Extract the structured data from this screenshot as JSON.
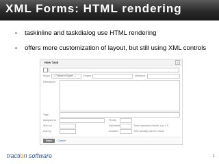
{
  "slide": {
    "title": "XML Forms: HTML rendering",
    "bullets": [
      "taskinline and taskdialog use HTML rendering",
      "offers more customization of layout, but still using XML controls"
    ],
    "footer_brand_prefix": "tracti",
    "footer_brand_dot": "o",
    "footer_brand_suffix": "n software",
    "page_number": "1"
  },
  "dialog": {
    "title": "New Task",
    "close_glyph": "×",
    "fields": {
      "space_label": "Space",
      "space_value": "— Choose a Space —",
      "project_label": "Project",
      "milestone_label": "Milestone",
      "description_label": "Description",
      "tags_label": "Tags",
      "assigned_label": "Assigned to",
      "priority_label": "Priority",
      "start_label": "Start on",
      "estimated_label": "Estimated",
      "estimated_hint": "Time expected to finish, e.g. 1.5",
      "due_label": "Due by",
      "duration_label": "Duration",
      "duration_hint": "Time actually spent in hours"
    },
    "save_label": "Save Task",
    "cancel_label": "Cancel"
  },
  "colors": {
    "title_bar": "#2a2a2a",
    "title_text": "#ffffff",
    "brand_text": "#3a5a8c",
    "brand_accent": "#e08a1e",
    "link": "#2a5db0"
  }
}
